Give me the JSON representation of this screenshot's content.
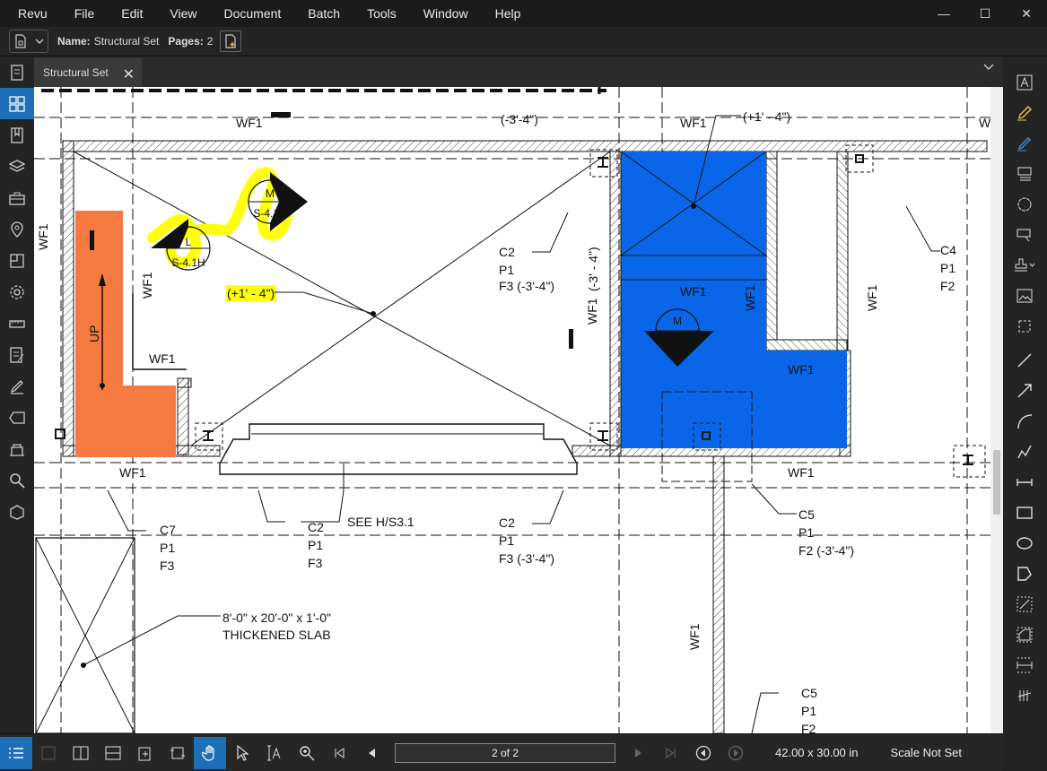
{
  "menu": [
    "Revu",
    "File",
    "Edit",
    "View",
    "Document",
    "Batch",
    "Tools",
    "Window",
    "Help"
  ],
  "window": {
    "minimize": "—",
    "maximize": "☐",
    "close": "✕"
  },
  "toolbar": {
    "name_label": "Name:",
    "name_value": "Structural Set",
    "pages_label": "Pages:",
    "pages_value": "2"
  },
  "tab": {
    "title": "Structural Set",
    "close": "✕"
  },
  "drawing": {
    "wf1": "WF1",
    "l": "L",
    "m": "M",
    "sheet_ref": "S-4.1H",
    "elev_plus": "(+1' - 4\")",
    "elev_minus": "(-3'-4\")",
    "elev_minus_v": "(-3' - 4\")",
    "c2": "C2",
    "c4": "C4",
    "c5": "C5",
    "c7": "C7",
    "p1": "P1",
    "f2": "F2",
    "f3": "F3",
    "f3_minus": "F3  (-3'-4\")",
    "f2_minus": "F2  (-3'-4\")",
    "up": "UP",
    "see": "SEE H/S3.1",
    "slab_dims": "8'-0\" x 20'-0\" x 1'-0\"",
    "slab_name": "THICKENED SLAB",
    "w": "W"
  },
  "status": {
    "page": "2 of 2",
    "size": "42.00 x 30.00 in",
    "scale": "Scale Not Set"
  },
  "colors": {
    "highlight": "#ffff00",
    "orange_fill": "#f47a42",
    "blue_fill": "#0a66e8",
    "accent": "#1d6fb8"
  }
}
